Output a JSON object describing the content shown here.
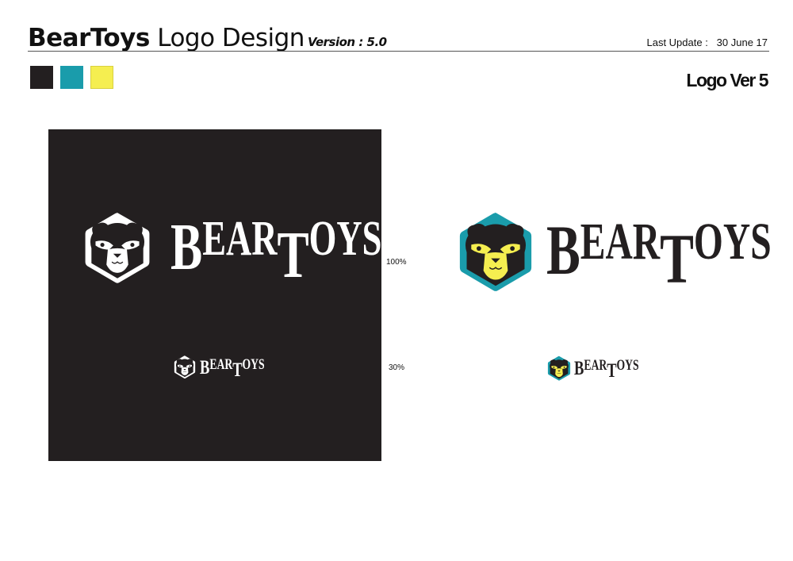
{
  "header": {
    "title_bold": "BearToys",
    "title_rest": "Logo Design",
    "version": "Version : 5.0",
    "last_update_label": "Last Update :",
    "last_update_value": "30 June 17"
  },
  "palette": [
    {
      "name": "black",
      "color": "#231f20"
    },
    {
      "name": "teal",
      "color": "#1a9cab"
    },
    {
      "name": "yellow",
      "color": "#f5ee50"
    }
  ],
  "section_label": "Logo Ver 5",
  "scales": {
    "full": "100%",
    "small": "30%"
  },
  "logo": {
    "wordmark": [
      "B",
      "EAR",
      "T",
      "OYS"
    ]
  }
}
